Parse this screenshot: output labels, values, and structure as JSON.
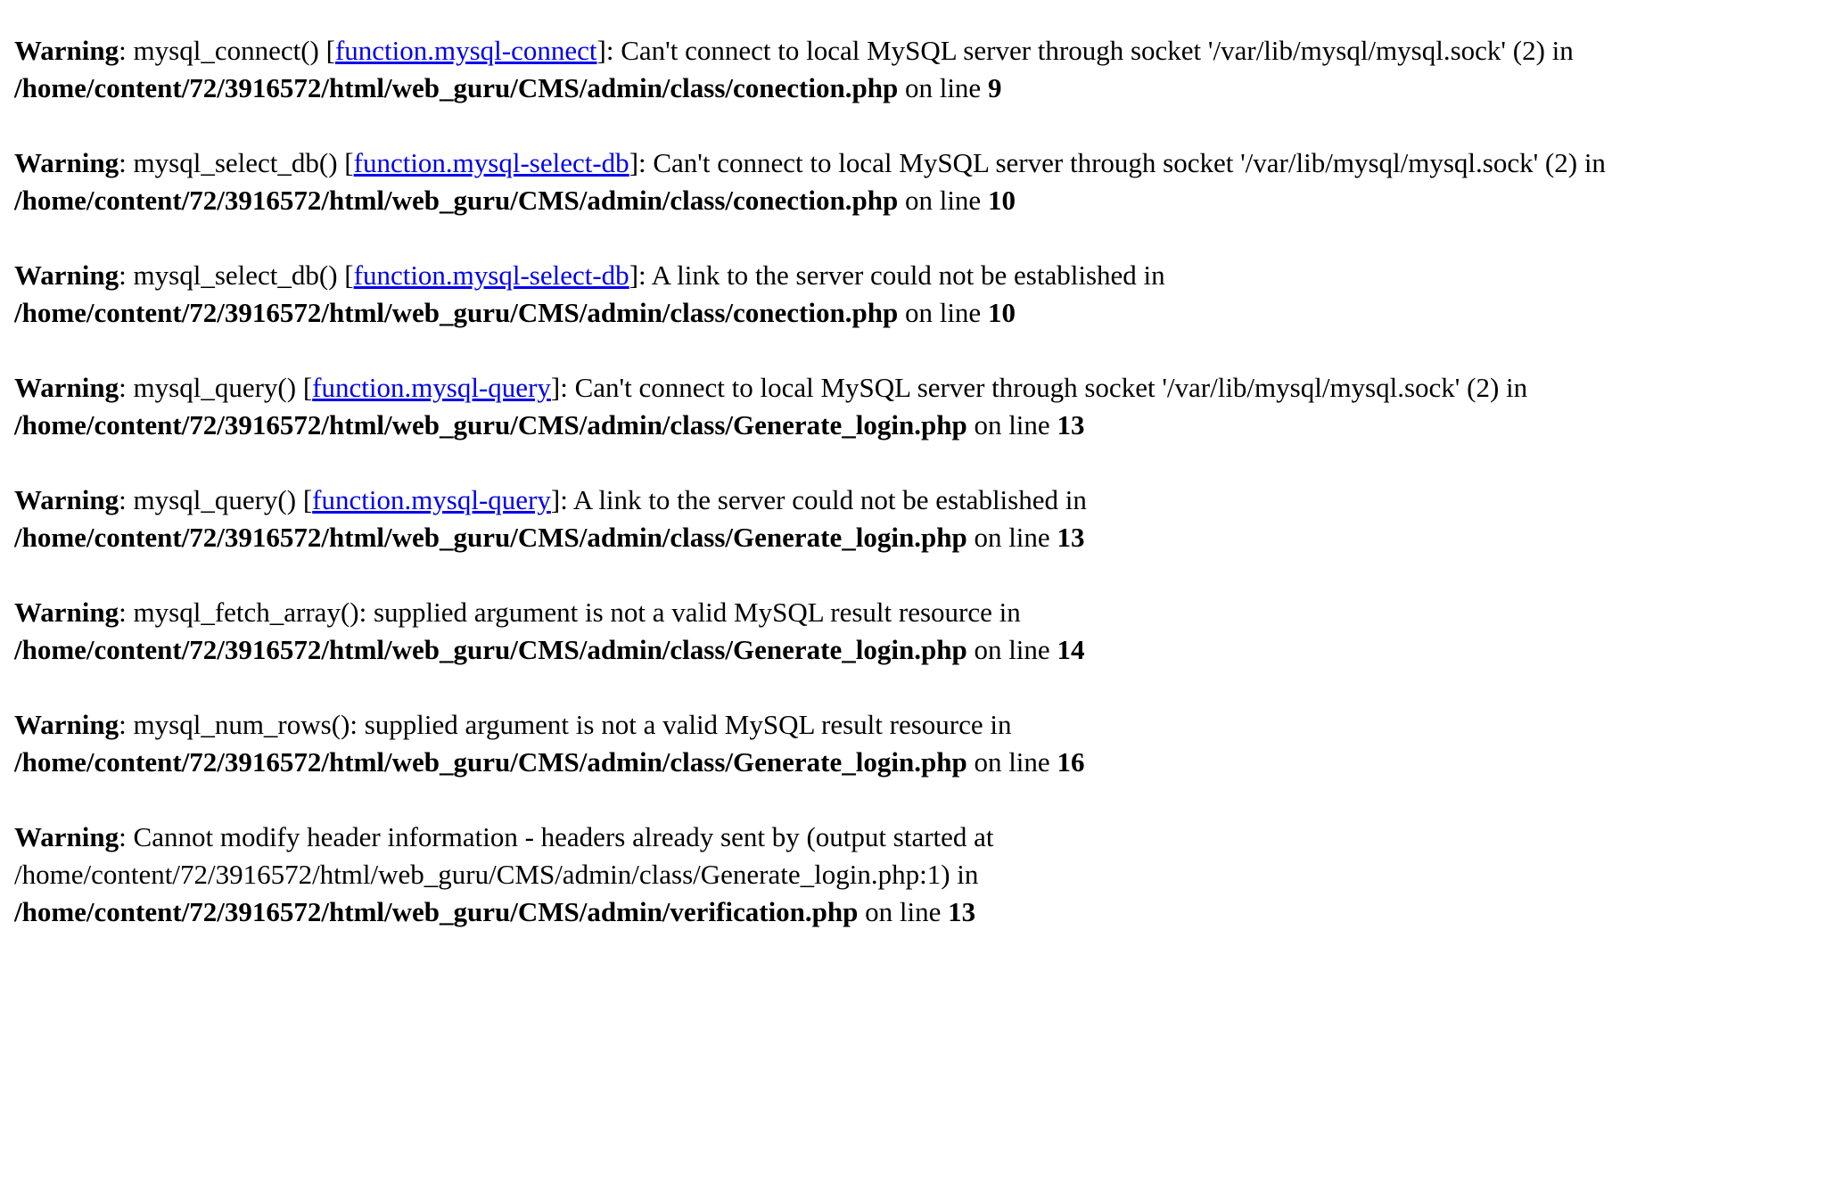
{
  "link_color": "#0000ee",
  "warnings": [
    {
      "label": "Warning",
      "func": "mysql_connect()",
      "link": "function.mysql-connect",
      "message": "Can't connect to local MySQL server through socket '/var/lib/mysql/mysql.sock' (2) in",
      "file": "/home/content/72/3916572/html/web_guru/CMS/admin/class/conection.php",
      "on_line": "on line",
      "line": "9"
    },
    {
      "label": "Warning",
      "func": "mysql_select_db()",
      "link": "function.mysql-select-db",
      "message": "Can't connect to local MySQL server through socket '/var/lib/mysql/mysql.sock' (2) in",
      "file": "/home/content/72/3916572/html/web_guru/CMS/admin/class/conection.php",
      "on_line": "on line",
      "line": "10"
    },
    {
      "label": "Warning",
      "func": "mysql_select_db()",
      "link": "function.mysql-select-db",
      "message": "A link to the server could not be established in",
      "file": "/home/content/72/3916572/html/web_guru/CMS/admin/class/conection.php",
      "on_line": "on line",
      "line": "10"
    },
    {
      "label": "Warning",
      "func": "mysql_query()",
      "link": "function.mysql-query",
      "message": "Can't connect to local MySQL server through socket '/var/lib/mysql/mysql.sock' (2) in",
      "file": "/home/content/72/3916572/html/web_guru/CMS/admin/class/Generate_login.php",
      "on_line": "on line",
      "line": "13"
    },
    {
      "label": "Warning",
      "func": "mysql_query()",
      "link": "function.mysql-query",
      "message": "A link to the server could not be established in",
      "file": "/home/content/72/3916572/html/web_guru/CMS/admin/class/Generate_login.php",
      "on_line": "on line",
      "line": "13"
    },
    {
      "label": "Warning",
      "text": "mysql_fetch_array(): supplied argument is not a valid MySQL result resource in",
      "file": "/home/content/72/3916572/html/web_guru/CMS/admin/class/Generate_login.php",
      "on_line": "on line",
      "line": "14"
    },
    {
      "label": "Warning",
      "text": "mysql_num_rows(): supplied argument is not a valid MySQL result resource in",
      "file": "/home/content/72/3916572/html/web_guru/CMS/admin/class/Generate_login.php",
      "on_line": "on line",
      "line": "16"
    },
    {
      "label": "Warning",
      "text": "Cannot modify header information - headers already sent by (output started at",
      "text2": "/home/content/72/3916572/html/web_guru/CMS/admin/class/Generate_login.php:1) in",
      "file": "/home/content/72/3916572/html/web_guru/CMS/admin/verification.php",
      "on_line": "on line",
      "line": "13"
    }
  ]
}
